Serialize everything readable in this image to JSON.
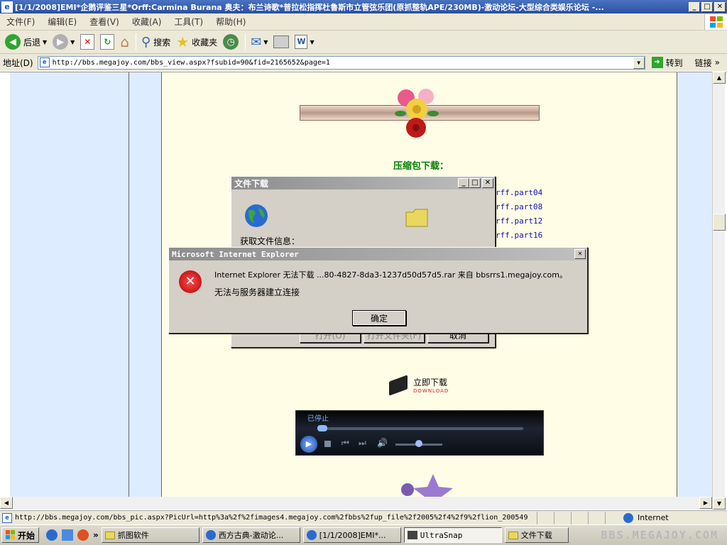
{
  "window": {
    "title": "[1/1/2008]EMI*企鹅评鉴三星*Orff:Carmina Burana 奥夫：布兰诗歌*普拉松指挥杜鲁斯市立管弦乐团(原抓整轨APE/230MB)-激动论坛-大型综合类娱乐论坛 -..."
  },
  "menu": [
    "文件(F)",
    "编辑(E)",
    "查看(V)",
    "收藏(A)",
    "工具(T)",
    "帮助(H)"
  ],
  "toolbar": {
    "back": "后退",
    "search": "搜索",
    "favorites": "收藏夹"
  },
  "address": {
    "label": "地址(D)",
    "url": "http://bbs.megajoy.com/bbs_view.aspx?fsubid=90&fid=2165652&page=1",
    "go": "转到",
    "links": "链接"
  },
  "page": {
    "heading": "压缩包下载：",
    "parts": [
      "rff.part04",
      "rff.part08",
      "rff.part12",
      "rff.part16"
    ],
    "download_now": "立即下载",
    "download_en": "DOWNLOAD",
    "player_status": "已停止"
  },
  "file_download_dialog": {
    "title": "文件下载",
    "info": "获取文件信息：",
    "open": "打开(O)",
    "open_folder": "打开文件夹(F)",
    "cancel": "取消"
  },
  "error_dialog": {
    "title": "Microsoft Internet Explorer",
    "message1": "Internet Explorer 无法下载 ...80-4827-8da3-1237d50d57d5.rar 来自 bbsrrs1.megajoy.com。",
    "message2": "无法与服务器建立连接",
    "ok": "确定"
  },
  "status": {
    "url": "http://bbs.megajoy.com/bbs_pic.aspx?PicUrl=http%3a%2f%2fimages4.megajoy.com%2fbbs%2fup_file%2f2005%2f4%2f9%2flion_200549",
    "zone": "Internet"
  },
  "taskbar": {
    "start": "开始",
    "tasks": [
      "抓图软件",
      "西方古典-激动论...",
      "[1/1/2008]EMI*...",
      "UltraSnap",
      "文件下载"
    ],
    "watermark": "BBS.MEGAJOY.COM"
  },
  "colors": {
    "page_bg": "#fffde6",
    "sidebar": "#ddecff",
    "heading_green": "#008000"
  }
}
